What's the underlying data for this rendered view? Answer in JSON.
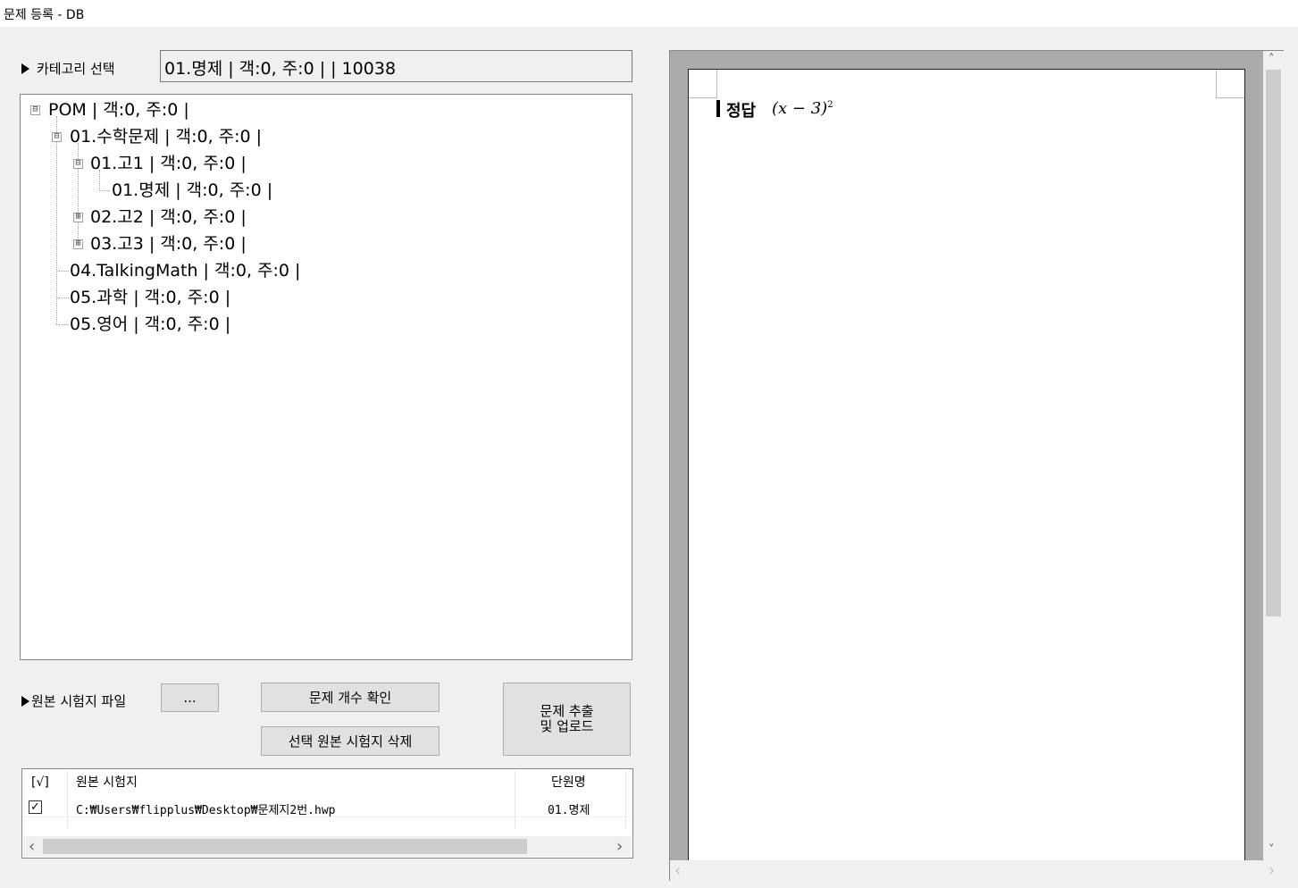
{
  "window": {
    "title": "문제 등록 - DB"
  },
  "category": {
    "label": "카테고리 선택",
    "selected": "01.명제 | 객:0, 주:0 | | 10038"
  },
  "tree": {
    "nodes": [
      "POM | 객:0, 주:0 |",
      "01.수학문제 | 객:0, 주:0 |",
      "01.고1 | 객:0, 주:0 |",
      "01.명제 | 객:0, 주:0 |",
      "02.고2 | 객:0, 주:0 |",
      "03.고3 | 객:0, 주:0 |",
      "04.TalkingMath | 객:0, 주:0 |",
      "05.과학 | 객:0, 주:0 |",
      "05.영어 | 객:0, 주:0 |"
    ],
    "expand_glyph": "⊞",
    "collapse_glyph": "⊟"
  },
  "source": {
    "label": "원본 시험지 파일",
    "browse_label": "...",
    "count_button": "문제 개수 확인",
    "delete_button": "선택 원본 시험지 삭제",
    "extract_button_line1": "문제 추출",
    "extract_button_line2": "및 업로드"
  },
  "filelist": {
    "headers": {
      "check": "[√]",
      "file": "원본 시험지",
      "unit": "단원명"
    },
    "rows": [
      {
        "checked": "✓",
        "file": "C:₩Users₩flipplus₩Desktop₩문제지2번.hwp",
        "unit": "01.명제"
      }
    ],
    "scroll_left": "‹",
    "scroll_right": "›"
  },
  "preview": {
    "answer_label": "정답",
    "answer_math": "(x − 3)",
    "answer_exp": "2",
    "scroll_up": "˄",
    "scroll_down": "˅",
    "scroll_left": "‹",
    "scroll_right": "›"
  }
}
